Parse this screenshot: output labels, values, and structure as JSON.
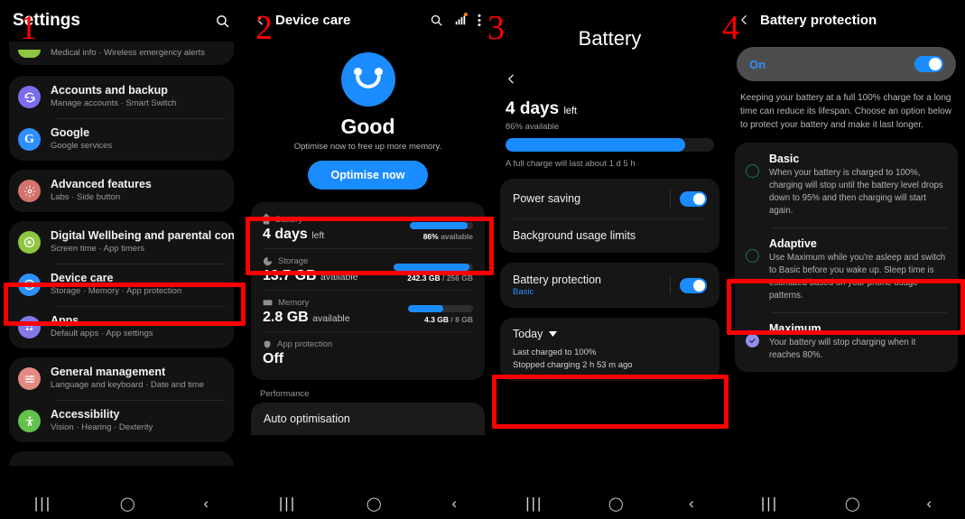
{
  "annotations": {
    "markers": [
      "1",
      "2",
      "3",
      "4"
    ]
  },
  "panel1": {
    "title": "Settings",
    "search_icon": "search-icon",
    "partial_row": {
      "subtitle": "Medical info  ·  Wireless emergency alerts"
    },
    "groups": [
      {
        "items": [
          {
            "title": "Accounts and backup",
            "subtitle": "Manage accounts  ·  Smart Switch",
            "icon": "sync-icon",
            "color": "#7a6df0"
          },
          {
            "title": "Google",
            "subtitle": "Google services",
            "icon": "google-icon",
            "color": "#2f8fff"
          }
        ]
      },
      {
        "items": [
          {
            "title": "Advanced features",
            "subtitle": "Labs  ·  Side button",
            "icon": "gear-icon",
            "color": "#d4736b"
          }
        ]
      },
      {
        "items": [
          {
            "title": "Digital Wellbeing and parental controls",
            "subtitle": "Screen time  ·  App timers",
            "icon": "wellbeing-icon",
            "color": "#8ec641"
          },
          {
            "title": "Device care",
            "subtitle": "Storage  ·  Memory  ·  App protection",
            "icon": "device-care-icon",
            "color": "#2f8fff"
          },
          {
            "title": "Apps",
            "subtitle": "Default apps  ·  App settings",
            "icon": "apps-grid-icon",
            "color": "#8179e8"
          }
        ]
      },
      {
        "items": [
          {
            "title": "General management",
            "subtitle": "Language and keyboard  ·  Date and time",
            "icon": "sliders-icon",
            "color": "#e38a82"
          },
          {
            "title": "Accessibility",
            "subtitle": "Vision  ·  Hearing  ·  Dexterity",
            "icon": "accessibility-icon",
            "color": "#62c24b"
          }
        ]
      }
    ],
    "navbar": {
      "recents": "|||",
      "home": "◯",
      "back": "‹"
    }
  },
  "panel2": {
    "title": "Device care",
    "icons": [
      "back-icon",
      "search-icon",
      "signal-bars-icon",
      "more-vertical-icon"
    ],
    "status": "Good",
    "status_hint": "Optimise now to free up more memory.",
    "optimise_button": "Optimise now",
    "stats": [
      {
        "label": "Battery",
        "icon": "battery-icon",
        "value": "4 days",
        "unit": "left",
        "bar_pct": 92,
        "caption_bold": "86%",
        "caption_rest": " available"
      },
      {
        "label": "Storage",
        "icon": "storage-pie-icon",
        "value": "13.7 GB",
        "unit": "available",
        "bar_pct": 95,
        "caption_bold": "242.3 GB",
        "caption_rest": " / 256 GB"
      },
      {
        "label": "Memory",
        "icon": "memory-icon",
        "value": "2.8 GB",
        "unit": "available",
        "bar_pct": 54,
        "caption_bold": "4.3 GB",
        "caption_rest": " / 8 GB"
      },
      {
        "label": "App protection",
        "icon": "shield-icon",
        "value": "Off",
        "unit": "",
        "bar_pct": 0,
        "caption_bold": "",
        "caption_rest": ""
      }
    ],
    "performance_header": "Performance",
    "auto_optimisation": "Auto optimisation",
    "navbar": {
      "recents": "|||",
      "home": "◯",
      "back": "‹"
    }
  },
  "panel3": {
    "title": "Battery",
    "back_icon": "back-icon",
    "days": "4 days",
    "days_unit": "left",
    "available": "86% available",
    "bar_pct": 86,
    "full_charge_note": "A full charge will last about 1 d 5 h",
    "rows": [
      {
        "name": "Power saving",
        "sub": "",
        "toggle": true
      },
      {
        "name": "Background usage limits",
        "sub": "",
        "toggle": false,
        "no_toggle": true
      },
      {
        "name": "Battery protection",
        "sub": "Basic",
        "toggle": true
      }
    ],
    "today": {
      "header": "Today",
      "caret_icon": "chevron-down-icon",
      "line1": "Last charged to 100%",
      "line2": "Stopped charging 2 h 53 m ago"
    },
    "navbar": {
      "recents": "|||",
      "home": "◯",
      "back": "‹"
    }
  },
  "panel4": {
    "title": "Battery protection",
    "back_icon": "back-icon",
    "toggle_label": "On",
    "toggle_on": true,
    "description": "Keeping your battery at a full 100% charge for a long time can reduce its lifespan. Choose an option below to protect your battery and make it last longer.",
    "options": [
      {
        "title": "Basic",
        "desc": "When your battery is charged to 100%, charging will stop until the battery level drops down to 95% and then charging will start again.",
        "selected": false
      },
      {
        "title": "Adaptive",
        "desc": "Use Maximum while you're asleep and switch to Basic before you wake up. Sleep time is estimated based on your phone usage patterns.",
        "selected": false
      },
      {
        "title": "Maximum",
        "desc": "Your battery will stop charging when it reaches 80%.",
        "selected": true
      }
    ],
    "navbar": {
      "recents": "|||",
      "home": "◯",
      "back": "‹"
    }
  },
  "colors": {
    "accent_blue": "#1a8cff",
    "link_blue": "#2f8fff",
    "annotation_red": "#ff0000",
    "radio_unselected": "#1f7a3f",
    "radio_selected": "#8d90ea"
  }
}
